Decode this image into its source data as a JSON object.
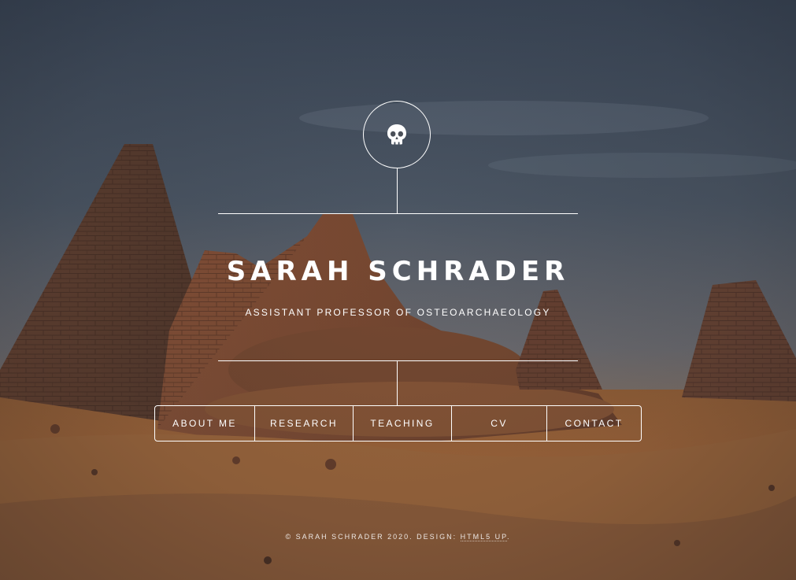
{
  "header": {
    "name": "SARAH SCHRADER",
    "tagline": "ASSISTANT PROFESSOR OF OSTEOARCHAEOLOGY",
    "logo_icon": "skull-icon"
  },
  "nav": {
    "items": [
      {
        "label": "ABOUT ME"
      },
      {
        "label": "RESEARCH"
      },
      {
        "label": "TEACHING"
      },
      {
        "label": "CV"
      },
      {
        "label": "CONTACT"
      }
    ]
  },
  "footer": {
    "copyright": "© SARAH SCHRADER 2020. DESIGN: ",
    "design_link": "HTML5 UP",
    "trailing": "."
  },
  "colors": {
    "line": "#ffffff",
    "sky_top": "#3d4a5c",
    "sand": "#b0703a"
  }
}
